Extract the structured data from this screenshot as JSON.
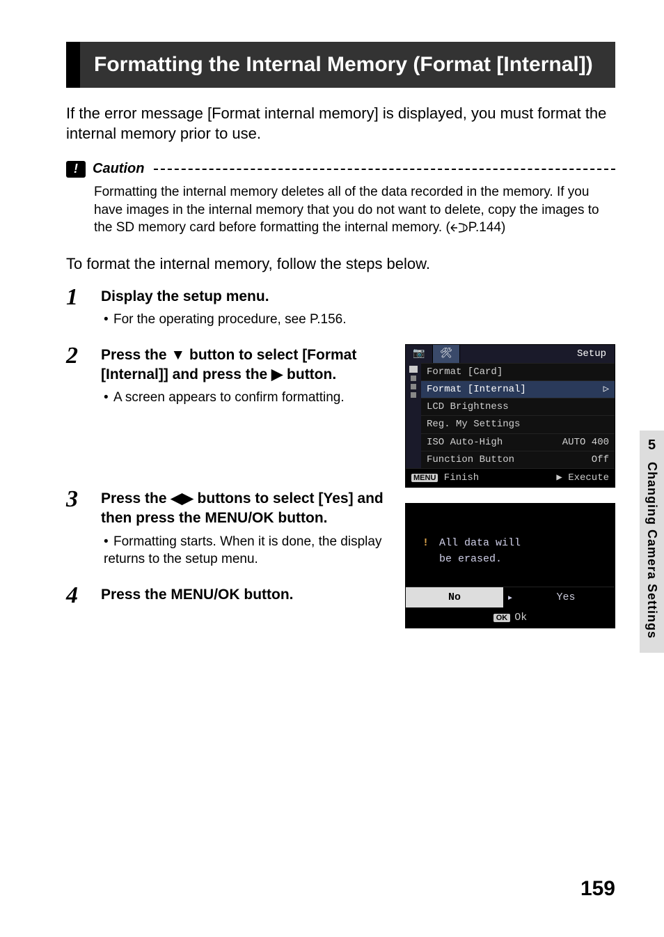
{
  "title": "Formatting the Internal Memory (Format [Internal])",
  "intro": "If the error message [Format internal memory] is displayed, you must format the internal memory prior to use.",
  "caution": {
    "label": "Caution",
    "body_prefix": "Formatting the internal memory deletes all of the data recorded in the memory. If you have images in the internal memory that you do not want to delete, copy the images to the SD memory card before formatting the internal memory. (",
    "page_ref": "P.144",
    "body_suffix": ")"
  },
  "lead": "To format the internal memory, follow the steps below.",
  "steps": {
    "s1": {
      "num": "1",
      "heading": "Display the setup menu.",
      "sub": "For the operating procedure, see P.156."
    },
    "s2": {
      "num": "2",
      "heading_a": "Press the ",
      "heading_b": " button to select [Format [Internal]] and press the ",
      "heading_c": " button.",
      "glyph_down": "▼",
      "glyph_right": "▶",
      "sub": "A screen appears to confirm formatting."
    },
    "s3": {
      "num": "3",
      "heading_a": "Press the ",
      "heading_b": " buttons to select [Yes] and then press the MENU/OK button.",
      "glyph_lr": "◀▶",
      "sub": "Formatting starts. When it is done, the display returns to the setup menu."
    },
    "s4": {
      "num": "4",
      "heading": "Press the MENU/OK button."
    }
  },
  "lcd1": {
    "tab_icons": {
      "camera": "◧",
      "tools": "👔"
    },
    "title": "Setup",
    "rows": [
      {
        "label": "Format [Card]",
        "value": "",
        "selected": false
      },
      {
        "label": "Format [Internal]",
        "value": "▷",
        "selected": true
      },
      {
        "label": "LCD Brightness",
        "value": "",
        "selected": false
      },
      {
        "label": "Reg. My Settings",
        "value": "",
        "selected": false
      },
      {
        "label": "ISO Auto-High",
        "value": "AUTO 400",
        "selected": false
      },
      {
        "label": "Function Button",
        "value": "Off",
        "selected": false
      }
    ],
    "footer": {
      "menu": "MENU",
      "finish": "Finish",
      "arrow": "▶",
      "execute": "Execute"
    }
  },
  "lcd2": {
    "msg_line1": "All data will",
    "msg_line2": "be erased.",
    "warn": "!",
    "no": "No",
    "yes": "Yes",
    "mid_arrow": "▸",
    "ok_badge": "OK",
    "ok": "Ok"
  },
  "side": {
    "chapter": "5",
    "label": "Changing Camera Settings"
  },
  "page_number": "159"
}
